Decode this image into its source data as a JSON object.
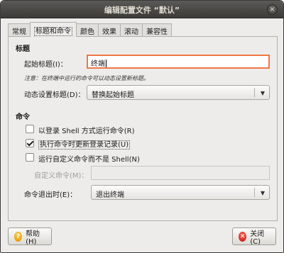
{
  "window": {
    "title": "编辑配置文件 “默认”",
    "close_glyph": "×"
  },
  "tabs": [
    {
      "label": "常规"
    },
    {
      "label": "标题和命令"
    },
    {
      "label": "颜色"
    },
    {
      "label": "效果"
    },
    {
      "label": "滚动"
    },
    {
      "label": "兼容性"
    }
  ],
  "title_section": {
    "heading": "标题",
    "initial_title_label": "起始标题(I)：",
    "initial_title_value": "终端",
    "note": "注意：在终端中运行的命令可以动态设置新标题。",
    "dynamic_label": "动态设置标题(D)：",
    "dynamic_value": "替换起始标题"
  },
  "command_section": {
    "heading": "命令",
    "login_shell_label": "以登录 Shell 方式运行命令(R)",
    "login_shell_checked": false,
    "update_records_label": "执行命令时更新登录记录(U)",
    "update_records_checked": true,
    "custom_cmd_label": "运行自定义命令而不是 Shell(N)",
    "custom_cmd_checked": false,
    "custom_cmd_field_label": "自定义命令(M)：",
    "custom_cmd_value": "",
    "on_exit_label": "命令退出时(E)：",
    "on_exit_value": "退出终端"
  },
  "footer": {
    "help_label": "帮助(H)",
    "close_label": "关闭(C)"
  }
}
